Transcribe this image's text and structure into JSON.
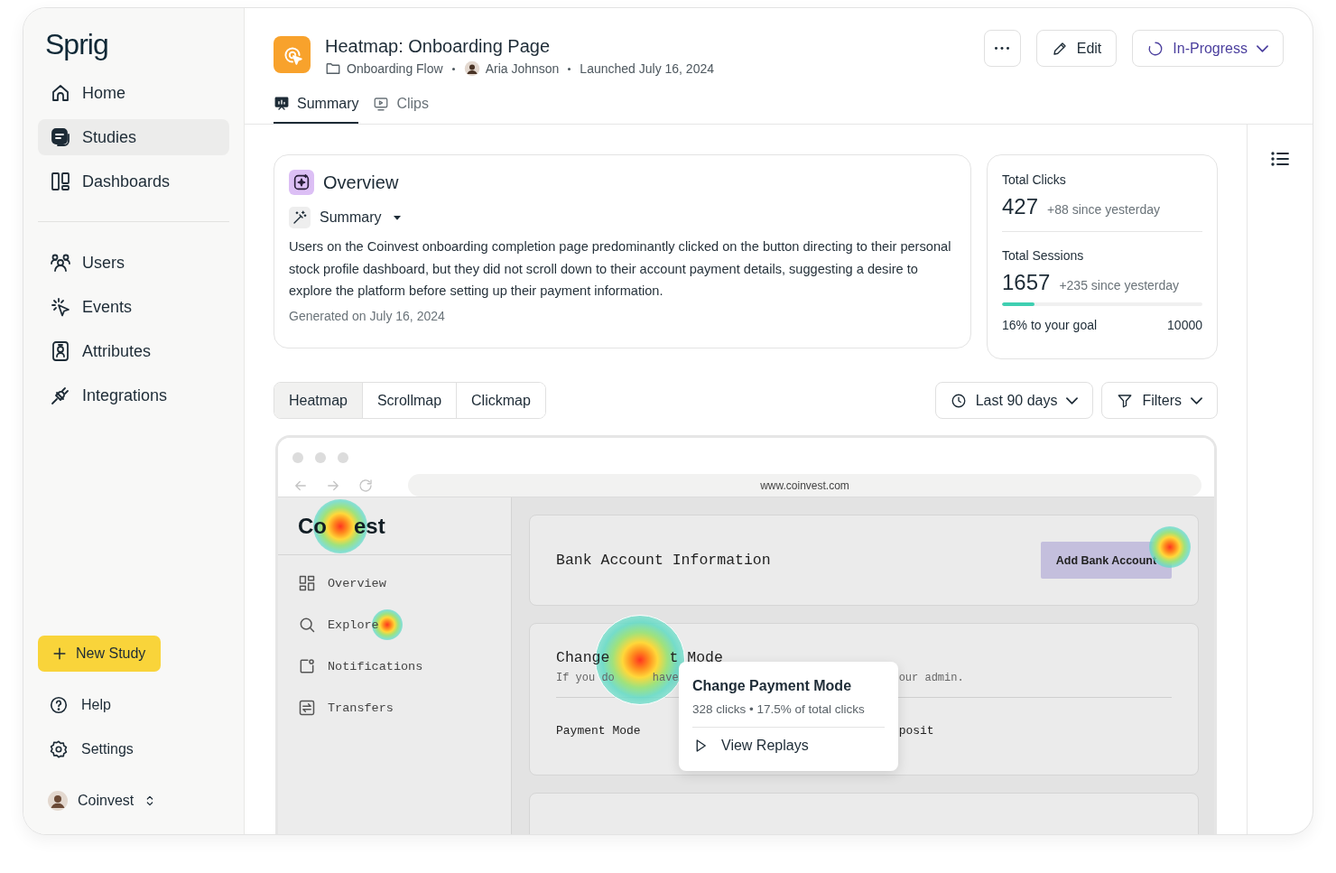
{
  "sidebar": {
    "logo": "Sprig",
    "nav": [
      {
        "label": "Home",
        "selected": false
      },
      {
        "label": "Studies",
        "selected": true
      },
      {
        "label": "Dashboards",
        "selected": false
      }
    ],
    "nav_secondary": [
      {
        "label": "Users",
        "selected": false
      },
      {
        "label": "Events",
        "selected": false
      },
      {
        "label": "Attributes",
        "selected": false
      },
      {
        "label": "Integrations",
        "selected": false
      }
    ],
    "new_study_button": "New Study",
    "footer_links": [
      {
        "label": "Help"
      },
      {
        "label": "Settings"
      }
    ],
    "workspace": "Coinvest"
  },
  "header": {
    "title": "Heatmap: Onboarding Page",
    "folder": "Onboarding Flow",
    "author": "Aria Johnson",
    "launched": "Launched July 16, 2024",
    "edit_button": "Edit",
    "status_button": "In-Progress"
  },
  "tabs": [
    {
      "label": "Summary",
      "selected": true
    },
    {
      "label": "Clips",
      "selected": false
    }
  ],
  "overview": {
    "title": "Overview",
    "section": "Summary",
    "text": "Users on the Coinvest onboarding completion page predominantly clicked on the button directing to their personal stock profile dashboard, but they did not scroll down to their account payment details, suggesting a desire to explore the platform before setting up their payment information.",
    "generated": "Generated on July 16, 2024"
  },
  "stats": {
    "clicks": {
      "label": "Total Clicks",
      "value": "427",
      "delta": "+88 since yesterday"
    },
    "sessions": {
      "label": "Total Sessions",
      "value": "1657",
      "delta": "+235 since yesterday"
    },
    "goal": {
      "label": "16% to your goal",
      "target": "10000",
      "level": 0.16
    }
  },
  "view_tabs": [
    {
      "label": "Heatmap",
      "selected": true
    },
    {
      "label": "Scrollmap",
      "selected": false
    },
    {
      "label": "Clickmap",
      "selected": false
    }
  ],
  "date_filter": "Last 90 days",
  "filters_button": "Filters",
  "preview": {
    "url": "www.coinvest.com",
    "logo_parts": [
      "Co",
      "est"
    ],
    "nav": [
      "Overview",
      "Explore",
      "Notifications",
      "Transfers"
    ],
    "bank_card": {
      "title": "Bank Account Information",
      "button": "Add Bank Account"
    },
    "payment_card": {
      "title_parts": [
        "Change",
        "t Mode"
      ],
      "note_parts": [
        "If you do",
        "have",
        "our admin."
      ],
      "row_parts": [
        "Payment Mode",
        "posit"
      ]
    },
    "tooltip": {
      "title": "Change Payment Mode",
      "stats": "328 clicks • 17.5% of total clicks",
      "action": "View Replays"
    }
  }
}
